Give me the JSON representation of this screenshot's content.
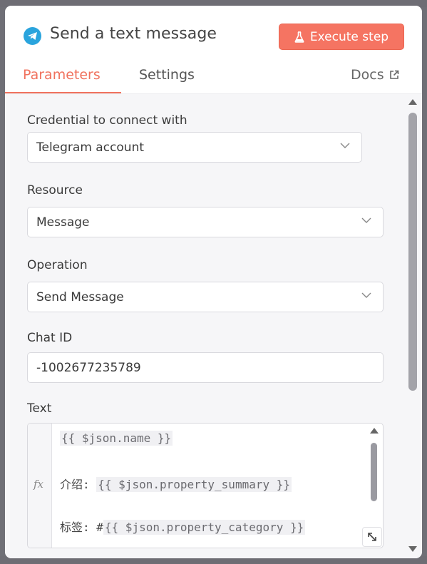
{
  "header": {
    "title": "Send a text message",
    "execute_label": "Execute step",
    "telegram_icon": "telegram-icon",
    "flask_icon": "flask-icon"
  },
  "tabs": {
    "parameters": "Parameters",
    "settings": "Settings",
    "docs": "Docs",
    "active": "Parameters"
  },
  "form": {
    "credential": {
      "label": "Credential to connect with",
      "value": "Telegram account"
    },
    "resource": {
      "label": "Resource",
      "value": "Message"
    },
    "operation": {
      "label": "Operation",
      "value": "Send Message"
    },
    "chat_id": {
      "label": "Chat ID",
      "value": "-1002677235789"
    },
    "text": {
      "label": "Text",
      "fx": "fx",
      "line1_expr": "{{ $json.name }}",
      "line2_prefix": "介绍: ",
      "line2_expr": "{{ $json.property_summary }}",
      "line3_prefix": "标签: #",
      "line3_expr": "{{ $json.property_category }}"
    }
  },
  "colors": {
    "accent": "#f0725e",
    "button": "#f57462",
    "telegram": "#2aa4dd"
  }
}
